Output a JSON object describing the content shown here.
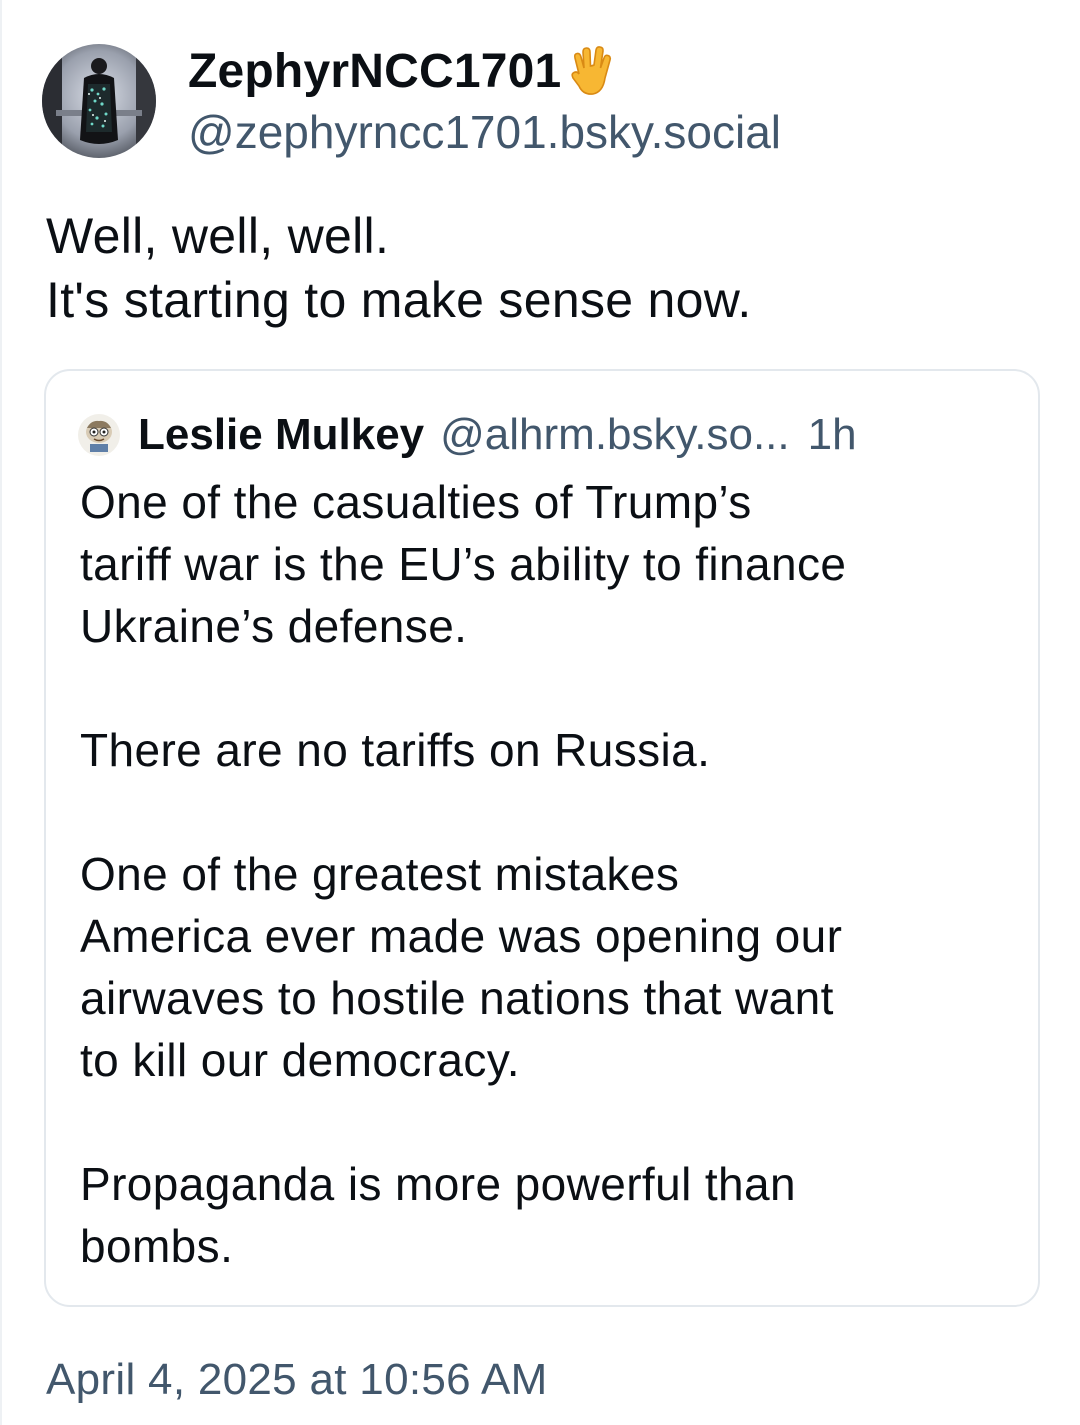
{
  "author": {
    "display_name": "ZephyrNCC1701",
    "name_emoji": "vulcan-salute-emoji",
    "handle": "@zephyrncc1701.bsky.social",
    "avatar_icon": "user-avatar"
  },
  "post": {
    "text": "Well, well, well.\nIt's starting to make sense now.",
    "timestamp": "April 4, 2025 at 10:56 AM"
  },
  "quote": {
    "avatar_icon": "cartoon-avatar",
    "name": "Leslie Mulkey",
    "handle": "@alhrm.bsky.so...",
    "time": "1h",
    "text": "One of the casualties of Trump’s\ntariff war is the EU’s ability to finance\nUkraine’s defense.\n\nThere are no tariffs on Russia.\n\nOne of the greatest mistakes\nAmerica ever made was opening our\nairwaves to hostile nations that want\nto kill our democracy.\n\nPropaganda is more powerful than\nbombs."
  },
  "colors": {
    "text": "#0b0f14",
    "secondary_text": "#42576c",
    "border": "#e3e8ed",
    "background": "#ffffff"
  }
}
